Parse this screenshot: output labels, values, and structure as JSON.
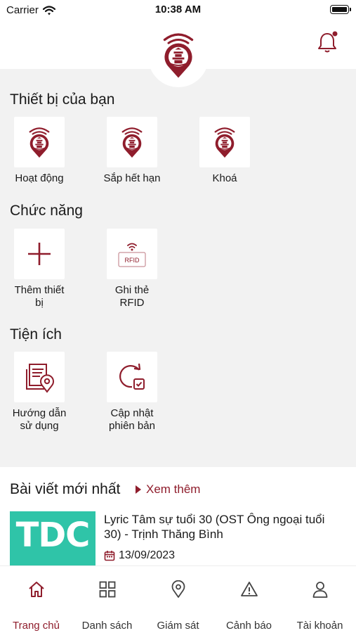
{
  "status_bar": {
    "carrier": "Carrier",
    "time": "10:38 AM"
  },
  "header": {
    "logo_icon": "brand-logo-pin",
    "notification_icon": "bell-icon",
    "has_badge": true
  },
  "colors": {
    "accent": "#8f1d2c",
    "background": "#f2f2f2",
    "thumbnail": "#2fc4a8"
  },
  "sections": {
    "devices": {
      "title": "Thiết bị của bạn",
      "items": [
        {
          "label": "Hoạt động",
          "icon": "device-logo-icon"
        },
        {
          "label": "Sắp hết hạn",
          "icon": "device-logo-icon"
        },
        {
          "label": "Khoá",
          "icon": "device-logo-icon"
        }
      ]
    },
    "functions": {
      "title": "Chức năng",
      "items": [
        {
          "label": "Thêm thiết bị",
          "icon": "plus-icon"
        },
        {
          "label": "Ghi thẻ RFID",
          "icon": "rfid-card-icon",
          "icon_text": "RFID"
        }
      ]
    },
    "utilities": {
      "title": "Tiện ích",
      "items": [
        {
          "label": "Hướng dẫn sử dụng",
          "icon": "guide-map-icon"
        },
        {
          "label": "Cập nhật phiên bản",
          "icon": "update-icon"
        }
      ]
    }
  },
  "posts": {
    "title": "Bài viết mới nhất",
    "see_more": "Xem thêm",
    "items": [
      {
        "thumb_text": "TDC",
        "title": "Lyric Tâm sự tuổi 30 (OST Ông ngoại tuổi 30) - Trịnh Thăng Bình",
        "date": "13/09/2023"
      }
    ]
  },
  "tabbar": {
    "active": 0,
    "items": [
      {
        "label": "Trang chủ",
        "icon": "home-icon"
      },
      {
        "label": "Danh sách",
        "icon": "grid-icon"
      },
      {
        "label": "Giám sát",
        "icon": "location-pin-icon"
      },
      {
        "label": "Cảnh báo",
        "icon": "warning-icon"
      },
      {
        "label": "Tài khoản",
        "icon": "user-icon"
      }
    ]
  }
}
